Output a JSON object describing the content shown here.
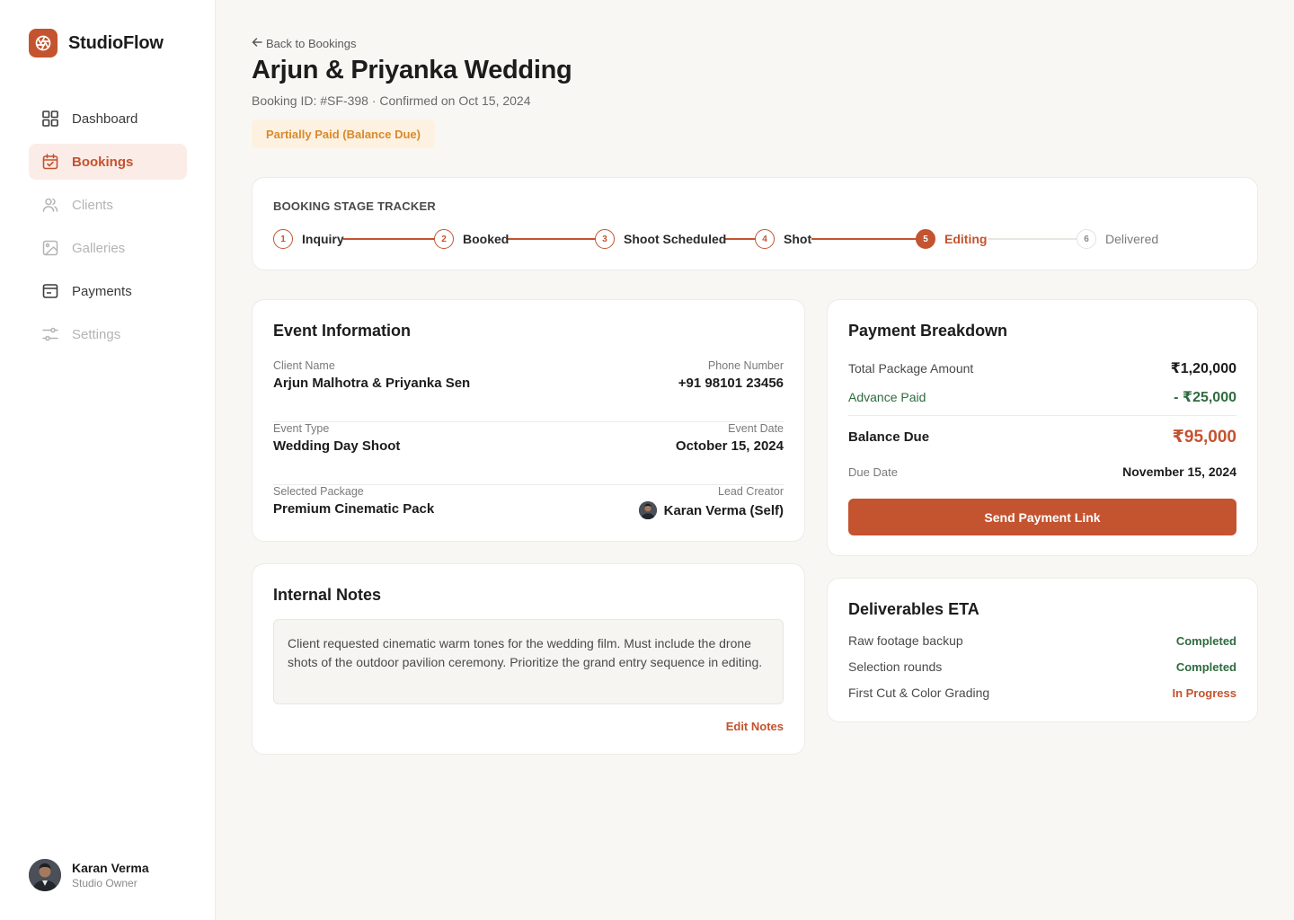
{
  "brand": {
    "name": "StudioFlow",
    "accent": "#c4532f"
  },
  "nav": {
    "items": [
      {
        "label": "Dashboard",
        "icon": "grid-icon"
      },
      {
        "label": "Bookings",
        "icon": "calendar-check-icon"
      },
      {
        "label": "Clients",
        "icon": "users-icon"
      },
      {
        "label": "Galleries",
        "icon": "image-icon"
      },
      {
        "label": "Payments",
        "icon": "wallet-icon"
      },
      {
        "label": "Settings",
        "icon": "sliders-icon"
      }
    ]
  },
  "user": {
    "name": "Karan Verma",
    "role": "Studio Owner"
  },
  "header": {
    "back_label": "Back to Bookings",
    "title": "Arjun & Priyanka Wedding",
    "meta": "Booking ID: #SF-398 · Confirmed on Oct 15, 2024",
    "badge": "Partially Paid (Balance Due)"
  },
  "tracker": {
    "title": "BOOKING STAGE TRACKER",
    "stages": [
      {
        "num": "1",
        "label": "Inquiry"
      },
      {
        "num": "2",
        "label": "Booked"
      },
      {
        "num": "3",
        "label": "Shoot Scheduled"
      },
      {
        "num": "4",
        "label": "Shot"
      },
      {
        "num": "5",
        "label": "Editing"
      },
      {
        "num": "6",
        "label": "Delivered"
      }
    ]
  },
  "event": {
    "title": "Event Information",
    "client_label": "Client Name",
    "client_value": "Arjun Malhotra & Priyanka Sen",
    "phone_label": "Phone Number",
    "phone_value": "+91 98101 23456",
    "type_label": "Event Type",
    "type_value": "Wedding Day Shoot",
    "date_label": "Event Date",
    "date_value": "October 15, 2024",
    "package_label": "Selected Package",
    "package_value": "Premium Cinematic Pack",
    "creator_label": "Lead Creator",
    "creator_value": "Karan Verma (Self)"
  },
  "notes": {
    "title": "Internal Notes",
    "text": "Client requested cinematic warm tones for the wedding film. Must include the drone shots of the outdoor pavilion ceremony. Prioritize the grand entry sequence in editing.",
    "edit_label": "Edit Notes"
  },
  "payment": {
    "title": "Payment Breakdown",
    "total_label": "Total Package Amount",
    "total_value": "₹1,20,000",
    "advance_label": "Advance Paid",
    "advance_value": "- ₹25,000",
    "balance_label": "Balance Due",
    "balance_value": "₹95,000",
    "due_label": "Due Date",
    "due_value": "November 15, 2024",
    "button_label": "Send Payment Link"
  },
  "deliverables": {
    "title": "Deliverables ETA",
    "items": [
      {
        "label": "Raw footage backup",
        "status": "Completed"
      },
      {
        "label": "Selection rounds",
        "status": "Completed"
      },
      {
        "label": "First Cut & Color Grading",
        "status": "In Progress"
      }
    ]
  }
}
